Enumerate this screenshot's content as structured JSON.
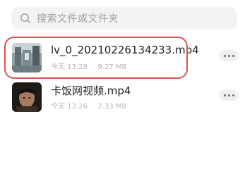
{
  "search": {
    "placeholder": "搜索文件或文件夹",
    "icon": "search-icon"
  },
  "files": [
    {
      "name": "lv_0_20210226134233.mp4",
      "day": "今天",
      "time": "13:28",
      "size": "9.27 MB",
      "thumbnail": "video-thumbnail-scene",
      "highlighted": true
    },
    {
      "name": "卡饭网视频.mp4",
      "day": "今天",
      "time": "13:26",
      "size": "2.33 MB",
      "thumbnail": "video-thumbnail-portrait",
      "highlighted": false
    }
  ],
  "colors": {
    "highlight": "#d9534f",
    "search_bg": "#f3f3f4",
    "meta_text": "#b5b6ba"
  }
}
